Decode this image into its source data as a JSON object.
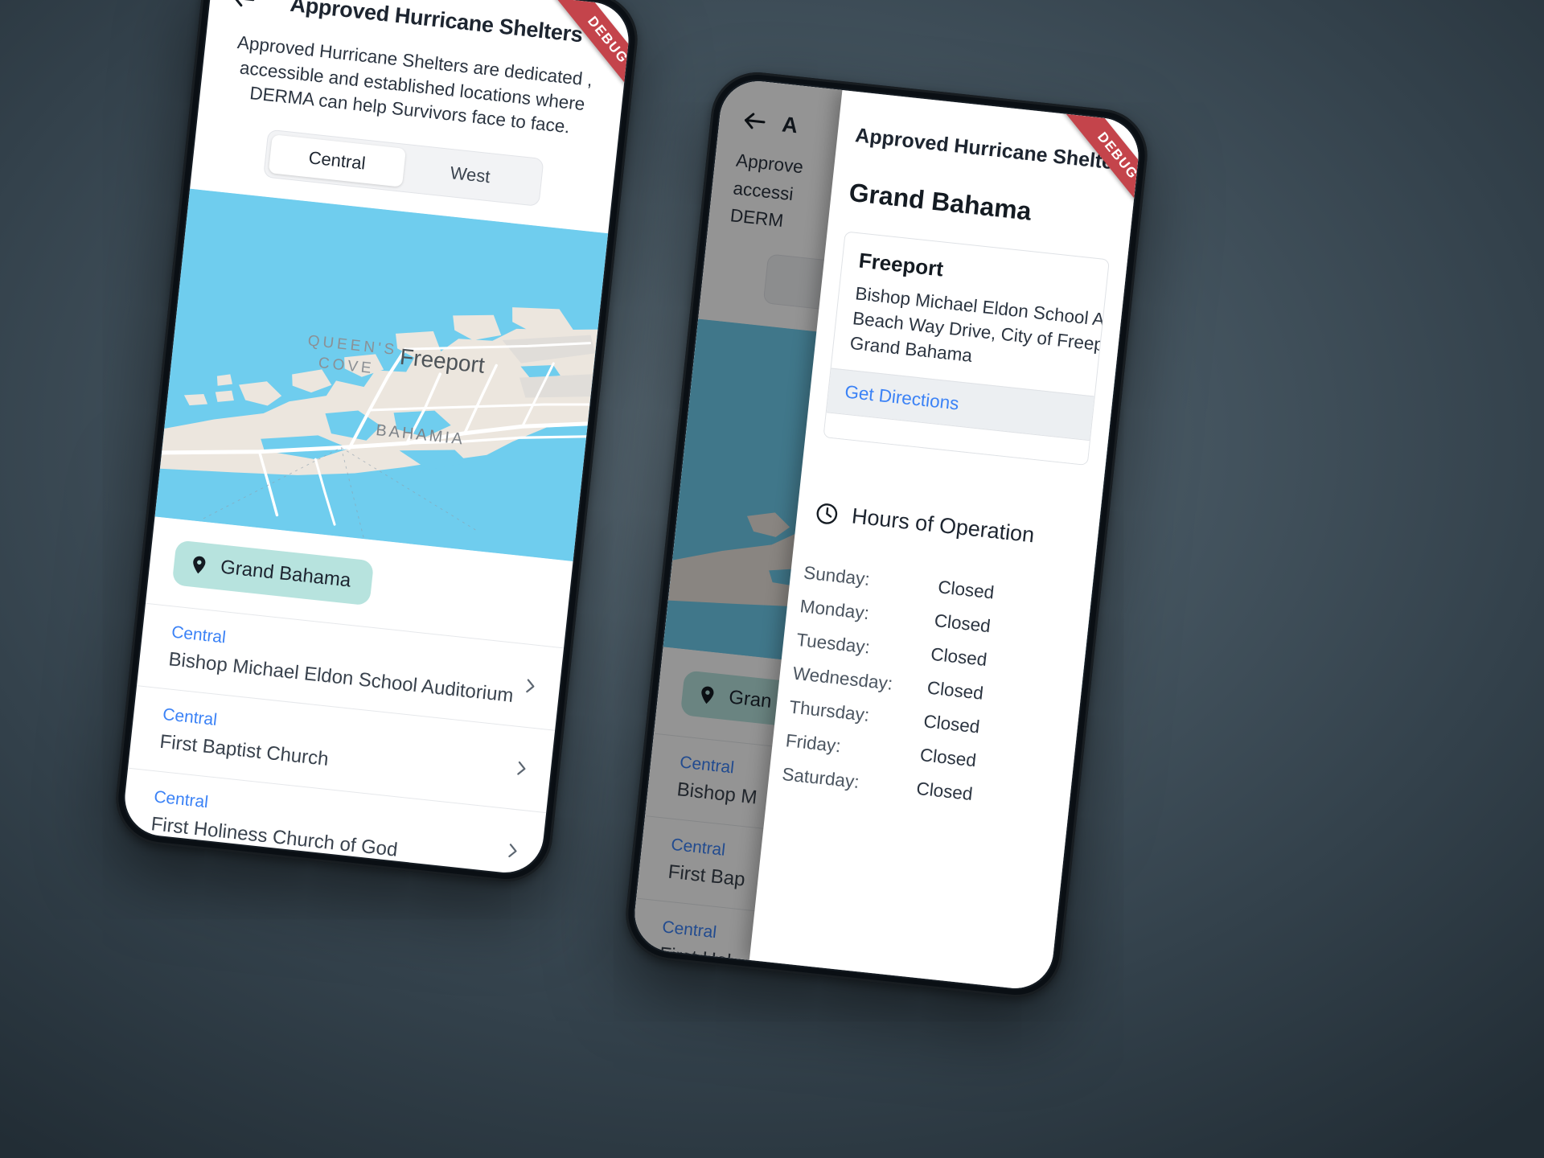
{
  "app": {
    "debug_ribbon": "DEBUG",
    "back_icon": "arrow-left-icon"
  },
  "left_phone": {
    "appbar": {
      "title": "Approved Hurricane Shelters",
      "back_label": "Back"
    },
    "intro": "Approved Hurricane Shelters are dedicated , accessible and established locations where DERMA can help Survivors face to face.",
    "segmented": {
      "options": [
        "Central",
        "West"
      ],
      "selected": "Central"
    },
    "map": {
      "labels": [
        "QUEEN'S",
        "COVE",
        "Freeport",
        "BAHAMIA"
      ],
      "water_color": "#6fcdee",
      "land_color": "#ece6de"
    },
    "island_chip": {
      "label": "Grand Bahama",
      "icon": "map-pin-icon",
      "background": "#b7e3de",
      "selected": true
    },
    "shelters": [
      {
        "region": "Central",
        "name": "Bishop Michael Eldon School Auditorium"
      },
      {
        "region": "Central",
        "name": "First Baptist Church"
      },
      {
        "region": "Central",
        "name": "First Holiness Church of God"
      }
    ]
  },
  "right_phone": {
    "background_screen": {
      "appbar_title": "A",
      "intro_fragment_1": "Approve",
      "intro_fragment_2": "accessi",
      "intro_fragment_3": "DERM",
      "chip_label": "Gran",
      "shelters": [
        {
          "region": "Central",
          "name": "Bishop M"
        },
        {
          "region": "Central",
          "name": "First Bap"
        },
        {
          "region": "Central",
          "name": "First Hol"
        }
      ]
    },
    "sheet": {
      "title": "Approved Hurricane Shelters",
      "island": "Grand Bahama",
      "address_card": {
        "city": "Freeport",
        "line1": "Bishop Michael Eldon School Auditorium",
        "line2": "Beach Way Drive, City of Freeport",
        "line3": "Grand Bahama",
        "action": "Get Directions",
        "action_color": "#3b82f6"
      },
      "hours": {
        "icon": "clock-icon",
        "heading": "Hours of Operation",
        "rows": [
          {
            "day": "Sunday:",
            "value": "Closed"
          },
          {
            "day": "Monday:",
            "value": "Closed"
          },
          {
            "day": "Tuesday:",
            "value": "Closed"
          },
          {
            "day": "Wednesday:",
            "value": "Closed"
          },
          {
            "day": "Thursday:",
            "value": "Closed"
          },
          {
            "day": "Friday:",
            "value": "Closed"
          },
          {
            "day": "Saturday:",
            "value": "Closed"
          }
        ]
      }
    }
  }
}
